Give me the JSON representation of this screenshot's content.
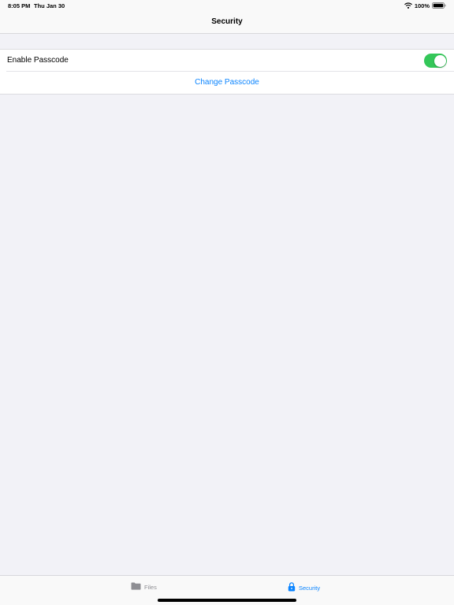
{
  "status_bar": {
    "time": "8:05 PM",
    "date": "Thu Jan 30",
    "battery": "100%",
    "icons": [
      "wifi-icon",
      "battery-icon"
    ]
  },
  "nav": {
    "title": "Security"
  },
  "settings": {
    "passcode_label": "Enable Passcode",
    "passcode_enabled": true,
    "change_passcode_label": "Change Passcode"
  },
  "tab_bar": {
    "tabs": [
      {
        "label": "Files",
        "icon": "folder-icon",
        "selected": false
      },
      {
        "label": "Security",
        "icon": "lock-icon",
        "selected": true
      }
    ]
  },
  "colors": {
    "accent": "#0a84ff",
    "toggle_on": "#34c759",
    "background": "#f2f2f7",
    "inactive_tab": "#8e8e93"
  }
}
